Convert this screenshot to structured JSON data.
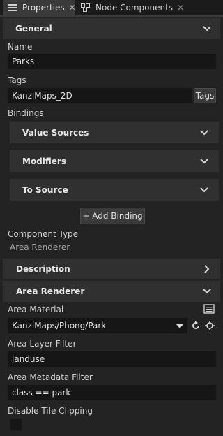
{
  "tabs": [
    {
      "label": "Properties",
      "icon": "list-icon",
      "active": true
    },
    {
      "label": "Node Components",
      "icon": "node-components-icon",
      "active": false
    }
  ],
  "general": {
    "title": "General",
    "name_label": "Name",
    "name_value": "Parks",
    "tags_label": "Tags",
    "tags_value": "KanziMaps_2D",
    "tags_button": "Tags",
    "bindings_label": "Bindings",
    "binding_sections": [
      "Value Sources",
      "Modifiers",
      "To Source"
    ],
    "add_binding": "+ Add Binding",
    "component_type_label": "Component Type",
    "component_type_value": "Area Renderer"
  },
  "description": {
    "title": "Description"
  },
  "area_renderer": {
    "title": "Area Renderer",
    "material_label": "Area Material",
    "material_value": "KanziMaps/Phong/Park",
    "layer_filter_label": "Area Layer Filter",
    "layer_filter_value": "landuse",
    "metadata_filter_label": "Area Metadata Filter",
    "metadata_filter_value": "class == park",
    "tile_clipping_label": "Disable Tile Clipping",
    "tile_clipping_checked": false
  },
  "colors": {
    "panel_bg": "#232323",
    "section_bg": "#303030",
    "field_bg": "#161616",
    "tab_active_bg": "#3a3a3a"
  }
}
